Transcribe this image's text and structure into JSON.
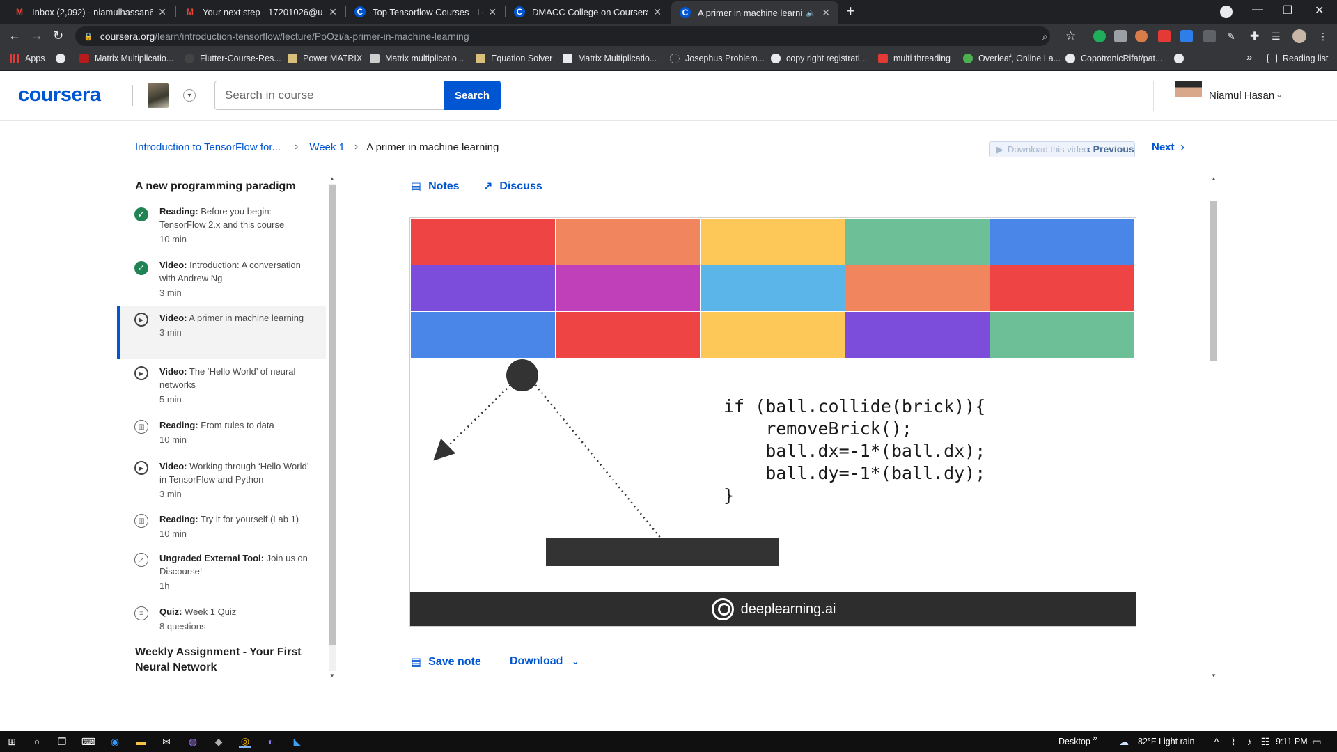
{
  "browser": {
    "tabs": [
      {
        "title": "Inbox (2,092) - niamulhassan64@",
        "favicon": "gmail-icon",
        "fav_letter": "M",
        "fav_color": "#ea4335"
      },
      {
        "title": "Your next step - 17201026@uap-",
        "favicon": "gmail-icon",
        "fav_letter": "M",
        "fav_color": "#ea4335"
      },
      {
        "title": "Top Tensorflow Courses - Learn T",
        "favicon": "coursera-icon",
        "fav_letter": "C",
        "fav_color": "#0056d2"
      },
      {
        "title": "DMACC College on Coursera | Co",
        "favicon": "coursera-icon",
        "fav_letter": "C",
        "fav_color": "#0056d2"
      },
      {
        "title": "A primer in machine learning",
        "favicon": "coursera-icon",
        "fav_letter": "C",
        "fav_color": "#0056d2"
      }
    ],
    "url_host": "coursera.org",
    "url_path": "/learn/introduction-tensorflow/lecture/PoOzi/a-primer-in-machine-learning",
    "bookmarks": [
      {
        "label": "Apps"
      },
      {
        "label": ""
      },
      {
        "label": "Matrix Multiplicatio..."
      },
      {
        "label": "Flutter-Course-Res..."
      },
      {
        "label": "Power MATRIX"
      },
      {
        "label": "Matrix multiplicatio..."
      },
      {
        "label": "Equation Solver"
      },
      {
        "label": "Matrix Multiplicatio..."
      },
      {
        "label": "Josephus Problem..."
      },
      {
        "label": "copy right registrati..."
      },
      {
        "label": "multi threading"
      },
      {
        "label": "Overleaf, Online La..."
      },
      {
        "label": "CopotronicRifat/pat..."
      }
    ],
    "reading_list": "Reading list",
    "more_bookmarks": "»"
  },
  "header": {
    "logo": "coursera",
    "search_placeholder": "Search in course",
    "search_button": "Search",
    "user_name": "Niamul Hasan"
  },
  "breadcrumb": {
    "course": "Introduction to TensorFlow for...",
    "week": "Week 1",
    "current": "A primer in machine learning"
  },
  "nav": {
    "download_video": "Download this video",
    "previous": "Previous",
    "next": "Next"
  },
  "sidebar": {
    "section_title": "A new programming paradigm",
    "items": [
      {
        "type": "Reading:",
        "title": "Before you begin: TensorFlow 2.x and this course",
        "duration": "10 min",
        "status": "done"
      },
      {
        "type": "Video:",
        "title": "Introduction: A conversation with Andrew Ng",
        "duration": "3 min",
        "status": "done"
      },
      {
        "type": "Video:",
        "title": "A primer in machine learning",
        "duration": "3 min",
        "status": "active"
      },
      {
        "type": "Video:",
        "title": "The ‘Hello World’ of neural networks",
        "duration": "5 min",
        "status": "video"
      },
      {
        "type": "Reading:",
        "title": "From rules to data",
        "duration": "10 min",
        "status": "reading"
      },
      {
        "type": "Video:",
        "title": "Working through ‘Hello World’ in TensorFlow and Python",
        "duration": "3 min",
        "status": "video"
      },
      {
        "type": "Reading:",
        "title": "Try it for yourself (Lab 1)",
        "duration": "10 min",
        "status": "reading"
      },
      {
        "type": "Ungraded External Tool:",
        "title": "Join us on Discourse!",
        "duration": "1h",
        "status": "external"
      },
      {
        "type": "Quiz:",
        "title": "Week 1 Quiz",
        "duration": "8 questions",
        "status": "quiz"
      }
    ],
    "section2_title": "Weekly Assignment - Your First Neural Network"
  },
  "main": {
    "notes": "Notes",
    "discuss": "Discuss",
    "save_note": "Save note",
    "download": "Download"
  },
  "video": {
    "brick_colors": [
      [
        "#ef4444",
        "#f0855e",
        "#fdc857",
        "#6dbf97",
        "#4a86e8"
      ],
      [
        "#7c4ddb",
        "#bf40b8",
        "#5bb5e8",
        "#f0855e",
        "#ef4444"
      ],
      [
        "#4a86e8",
        "#ef4444",
        "#fdc857",
        "#7c4ddb",
        "#6dbf97"
      ]
    ],
    "code": "if (ball.collide(brick)){\n    removeBrick();\n    ball.dx=-1*(ball.dx);\n    ball.dy=-1*(ball.dy);\n}",
    "brand": "deeplearning.ai"
  },
  "taskbar": {
    "desktop": "Desktop",
    "weather": "82°F  Light rain",
    "time": "9:11 PM"
  }
}
